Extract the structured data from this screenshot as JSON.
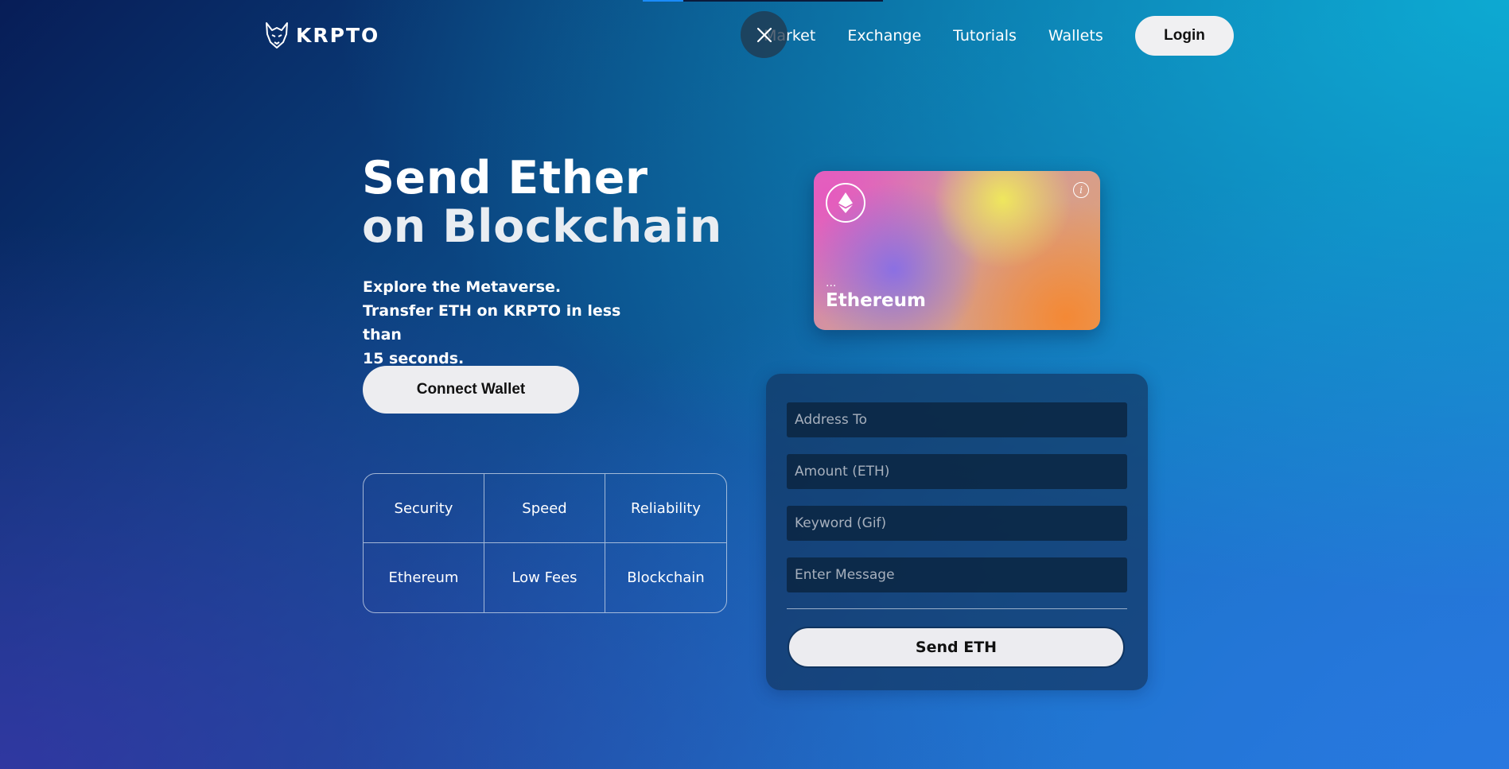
{
  "brand": {
    "name": "KRPTO"
  },
  "loading": {
    "progress": 0.17
  },
  "nav": {
    "links": [
      "Market",
      "Exchange",
      "Tutorials",
      "Wallets"
    ],
    "login_label": "Login"
  },
  "overlay": {
    "close_icon": "close-icon"
  },
  "hero": {
    "title_line1": "Send Ether",
    "title_line2": "on Blockchain",
    "subtitle_line1": "Explore the Metaverse.",
    "subtitle_line2": "Transfer ETH on KRPTO in less than",
    "subtitle_line3": "15 seconds.",
    "connect_label": "Connect Wallet"
  },
  "features": [
    "Security",
    "Speed",
    "Reliability",
    "Ethereum",
    "Low Fees",
    "Blockchain"
  ],
  "card": {
    "address": "...",
    "network": "Ethereum",
    "icons": [
      "ethereum-icon",
      "info-icon"
    ],
    "info_glyph": "i"
  },
  "form": {
    "address_placeholder": "Address To",
    "amount_placeholder": "Amount (ETH)",
    "keyword_placeholder": "Keyword (Gif)",
    "message_placeholder": "Enter Message",
    "send_label": "Send ETH"
  },
  "colors": {
    "button_bg": "#ededf0",
    "loading_accent": "#1a8cff"
  }
}
